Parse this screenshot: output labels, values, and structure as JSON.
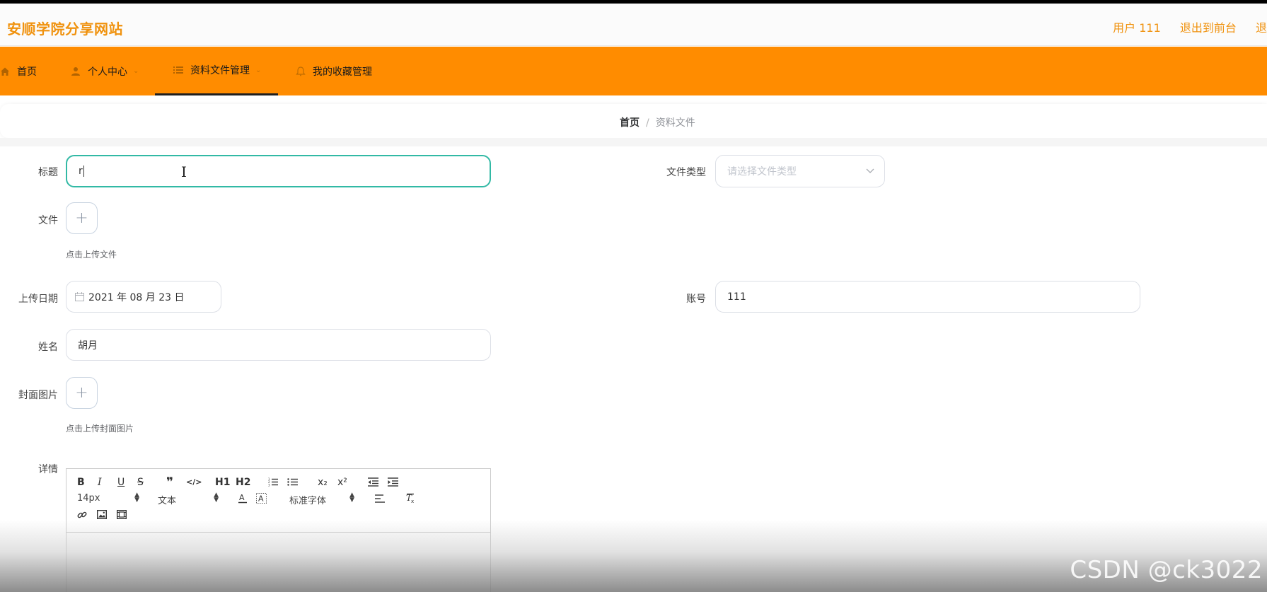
{
  "app": {
    "brand": "安顺学院分享网站"
  },
  "header": {
    "user": "用户 111",
    "exit_front": "退出到前台",
    "exit_cut": "退"
  },
  "nav": {
    "items": [
      {
        "label": "首页",
        "icon": "home-icon"
      },
      {
        "label": "个人中心",
        "icon": "user-icon"
      },
      {
        "label": "资料文件管理",
        "icon": "list-icon",
        "active": true
      },
      {
        "label": "我的收藏管理",
        "icon": "bell-icon"
      }
    ]
  },
  "breadcrumb": {
    "home": "首页",
    "separator": "/",
    "current": "资料文件"
  },
  "form": {
    "title": {
      "label": "标题",
      "value": "r"
    },
    "file_type": {
      "label": "文件类型",
      "placeholder": "请选择文件类型"
    },
    "file": {
      "label": "文件",
      "hint": "点击上传文件"
    },
    "upload_date": {
      "label": "上传日期",
      "value": "2021 年 08 月 23 日"
    },
    "account": {
      "label": "账号",
      "value": "111"
    },
    "name": {
      "label": "姓名",
      "value": "胡月"
    },
    "cover": {
      "label": "封面图片",
      "hint": "点击上传封面图片"
    },
    "detail": {
      "label": "详情"
    }
  },
  "editor": {
    "row1": [
      "B",
      "I",
      "U",
      "S",
      "❞",
      "</>",
      "H1",
      "H2",
      "ol",
      "ul",
      "x₂",
      "x²",
      "outdent",
      "indent"
    ],
    "font_size": "14px",
    "header_select": "文本",
    "font_select": "标准字体"
  },
  "watermark": "CSDN @ck3022"
}
